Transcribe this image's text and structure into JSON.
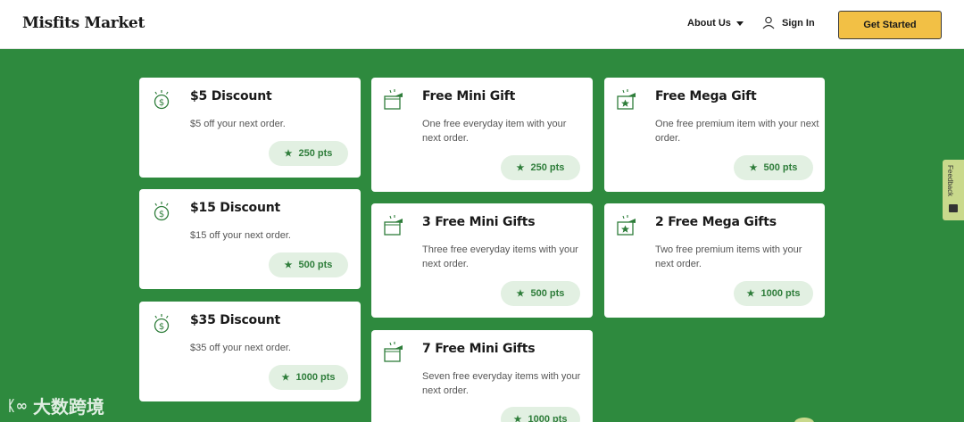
{
  "header": {
    "logo": "Misfits Market",
    "about_label": "About Us",
    "signin_label": "Sign In",
    "cta_label": "Get Started"
  },
  "rewards": [
    {
      "title": "$5 Discount",
      "desc": "$5 off your next order.",
      "pts": "250 pts",
      "icon": "dollar-coin-icon"
    },
    {
      "title": "$15 Discount",
      "desc": "$15 off your next order.",
      "pts": "500 pts",
      "icon": "dollar-coin-icon"
    },
    {
      "title": "$35 Discount",
      "desc": "$35 off your next order.",
      "pts": "1000 pts",
      "icon": "dollar-coin-icon"
    },
    {
      "title": "Free Mini Gift",
      "desc": "One free everyday item with your next order.",
      "pts": "250 pts",
      "icon": "gift-box-icon"
    },
    {
      "title": "3 Free Mini Gifts",
      "desc": "Three free everyday items with your next order.",
      "pts": "500 pts",
      "icon": "gift-box-icon"
    },
    {
      "title": "7 Free Mini Gifts",
      "desc": "Seven free everyday items with your next order.",
      "pts": "1000 pts",
      "icon": "gift-box-icon"
    },
    {
      "title": "Free Mega Gift",
      "desc": "One free premium item with your next order.",
      "pts": "500 pts",
      "icon": "premium-gift-icon"
    },
    {
      "title": "2 Free Mega Gifts",
      "desc": "Two free premium items with your next order.",
      "pts": "1000 pts",
      "icon": "premium-gift-icon"
    }
  ],
  "feedback_label": "Feedback",
  "watermark": "大数跨境",
  "colors": {
    "background": "#2e8a3e",
    "accent": "#f2c045",
    "pill_bg": "#e2f0e2",
    "pill_text": "#2e7d3a"
  }
}
